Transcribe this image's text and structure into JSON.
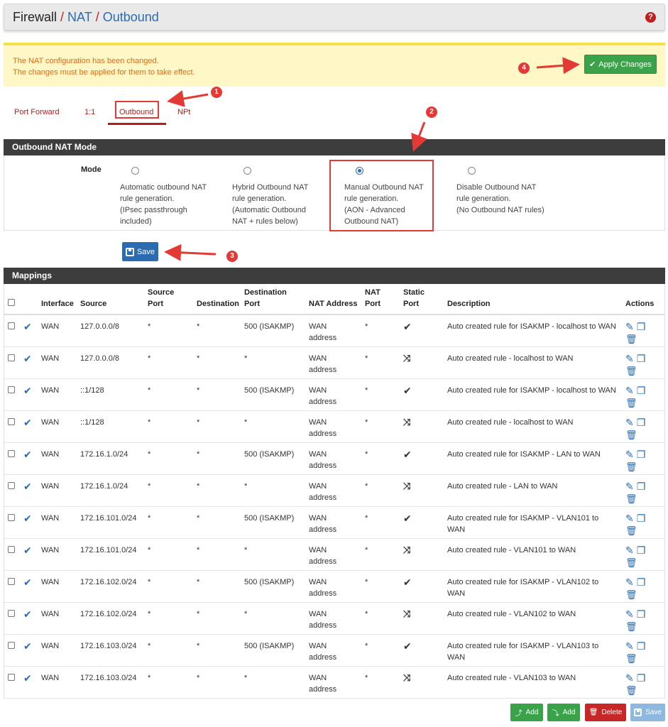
{
  "header": {
    "crumb_main": "Firewall",
    "crumb_nat": "NAT",
    "crumb_outbound": "Outbound",
    "sep": "/",
    "help": "?"
  },
  "alert": {
    "line1": "The NAT configuration has been changed.",
    "line2": "The changes must be applied for them to take effect.",
    "apply_label": "Apply Changes"
  },
  "tabs": [
    "Port Forward",
    "1:1",
    "Outbound",
    "NPt"
  ],
  "mode_panel": {
    "title": "Outbound NAT Mode",
    "label": "Mode",
    "options": [
      {
        "lines": [
          "Automatic outbound NAT",
          "rule generation.",
          "(IPsec passthrough",
          "included)"
        ],
        "checked": false
      },
      {
        "lines": [
          "Hybrid Outbound NAT",
          "rule generation.",
          "(Automatic Outbound",
          "NAT + rules below)"
        ],
        "checked": false
      },
      {
        "lines": [
          "Manual Outbound NAT",
          "rule generation.",
          "(AON - Advanced",
          "Outbound NAT)"
        ],
        "checked": true
      },
      {
        "lines": [
          "Disable Outbound NAT",
          "rule generation.",
          "(No Outbound NAT rules)"
        ],
        "checked": false
      }
    ],
    "save_label": "Save"
  },
  "mappings": {
    "title": "Mappings",
    "headers": {
      "interface": "Interface",
      "source": "Source",
      "source_port": [
        "Source",
        "Port"
      ],
      "destination": "Destination",
      "destination_port": [
        "Destination",
        "Port"
      ],
      "nat_address": "NAT Address",
      "nat_port": [
        "NAT",
        "Port"
      ],
      "static_port": [
        "Static",
        "Port"
      ],
      "description": "Description",
      "actions": "Actions"
    },
    "rows": [
      {
        "iface": "WAN",
        "source": "127.0.0.0/8",
        "sport": "*",
        "dest": "*",
        "dport": "500 (ISAKMP)",
        "nat1": "WAN",
        "nat2": "address",
        "natport": "*",
        "static": "check",
        "desc": "Auto created rule for ISAKMP - localhost to WAN"
      },
      {
        "iface": "WAN",
        "source": "127.0.0.0/8",
        "sport": "*",
        "dest": "*",
        "dport": "*",
        "nat1": "WAN",
        "nat2": "address",
        "natport": "*",
        "static": "shuffle",
        "desc": "Auto created rule - localhost to WAN"
      },
      {
        "iface": "WAN",
        "source": "::1/128",
        "sport": "*",
        "dest": "*",
        "dport": "500 (ISAKMP)",
        "nat1": "WAN",
        "nat2": "address",
        "natport": "*",
        "static": "check",
        "desc": "Auto created rule for ISAKMP - localhost to WAN"
      },
      {
        "iface": "WAN",
        "source": "::1/128",
        "sport": "*",
        "dest": "*",
        "dport": "*",
        "nat1": "WAN",
        "nat2": "address",
        "natport": "*",
        "static": "shuffle",
        "desc": "Auto created rule - localhost to WAN"
      },
      {
        "iface": "WAN",
        "source": "172.16.1.0/24",
        "sport": "*",
        "dest": "*",
        "dport": "500 (ISAKMP)",
        "nat1": "WAN",
        "nat2": "address",
        "natport": "*",
        "static": "check",
        "desc": "Auto created rule for ISAKMP - LAN to WAN"
      },
      {
        "iface": "WAN",
        "source": "172.16.1.0/24",
        "sport": "*",
        "dest": "*",
        "dport": "*",
        "nat1": "WAN",
        "nat2": "address",
        "natport": "*",
        "static": "shuffle",
        "desc": "Auto created rule - LAN to WAN"
      },
      {
        "iface": "WAN",
        "source": "172.16.101.0/24",
        "sport": "*",
        "dest": "*",
        "dport": "500 (ISAKMP)",
        "nat1": "WAN",
        "nat2": "address",
        "natport": "*",
        "static": "check",
        "desc": "Auto created rule for ISAKMP - VLAN101 to WAN"
      },
      {
        "iface": "WAN",
        "source": "172.16.101.0/24",
        "sport": "*",
        "dest": "*",
        "dport": "*",
        "nat1": "WAN",
        "nat2": "address",
        "natport": "*",
        "static": "shuffle",
        "desc": "Auto created rule - VLAN101 to WAN"
      },
      {
        "iface": "WAN",
        "source": "172.16.102.0/24",
        "sport": "*",
        "dest": "*",
        "dport": "500 (ISAKMP)",
        "nat1": "WAN",
        "nat2": "address",
        "natport": "*",
        "static": "check",
        "desc": "Auto created rule for ISAKMP - VLAN102 to WAN"
      },
      {
        "iface": "WAN",
        "source": "172.16.102.0/24",
        "sport": "*",
        "dest": "*",
        "dport": "*",
        "nat1": "WAN",
        "nat2": "address",
        "natport": "*",
        "static": "shuffle",
        "desc": "Auto created rule - VLAN102 to WAN"
      },
      {
        "iface": "WAN",
        "source": "172.16.103.0/24",
        "sport": "*",
        "dest": "*",
        "dport": "500 (ISAKMP)",
        "nat1": "WAN",
        "nat2": "address",
        "natport": "*",
        "static": "check",
        "desc": "Auto created rule for ISAKMP - VLAN103 to WAN"
      },
      {
        "iface": "WAN",
        "source": "172.16.103.0/24",
        "sport": "*",
        "dest": "*",
        "dport": "*",
        "nat1": "WAN",
        "nat2": "address",
        "natport": "*",
        "static": "shuffle",
        "desc": "Auto created rule - VLAN103 to WAN"
      }
    ]
  },
  "bottom_buttons": {
    "add_top": "Add",
    "add_bottom": "Add",
    "delete": "Delete",
    "save": "Save"
  },
  "annotations": [
    "1",
    "2",
    "3",
    "4"
  ],
  "icons": {
    "check": "✔",
    "shuffle": "⤨",
    "edit": "✎",
    "copy": "❐",
    "trash": "🗑"
  },
  "colors": {
    "accent_red": "#b71c1c",
    "link_blue": "#2b6cb0",
    "success_green": "#3aa34a",
    "warning_bg": "#fff7c6",
    "warning_text": "#e56b13",
    "panel_dark": "#3d3d3d",
    "annotation_red": "#e53935"
  }
}
